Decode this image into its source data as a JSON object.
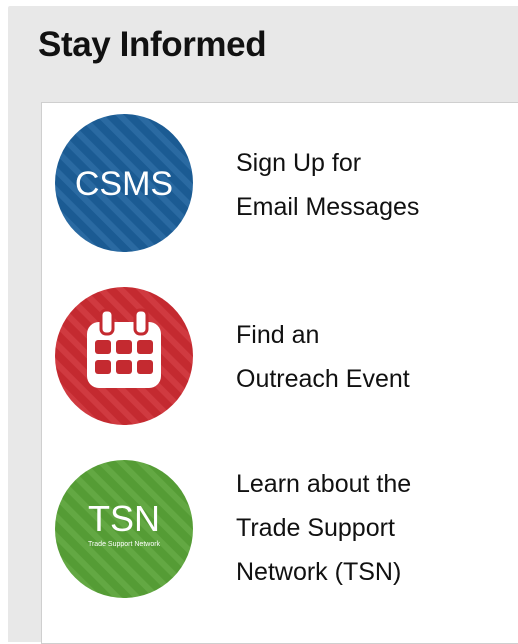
{
  "panel": {
    "title": "Stay Informed"
  },
  "items": [
    {
      "icon_name": "csms-icon",
      "icon_text": "CSMS",
      "color": "#1b5b93",
      "lines": [
        "Sign Up for",
        "Email Messages"
      ]
    },
    {
      "icon_name": "calendar-icon",
      "color": "#c42a30",
      "lines": [
        "Find an",
        "Outreach Event"
      ]
    },
    {
      "icon_name": "tsn-icon",
      "icon_text": "TSN",
      "icon_subtext": "Trade Support Network",
      "color": "#559c35",
      "lines": [
        "Learn about the",
        "Trade Support",
        "Network (TSN)"
      ]
    }
  ]
}
